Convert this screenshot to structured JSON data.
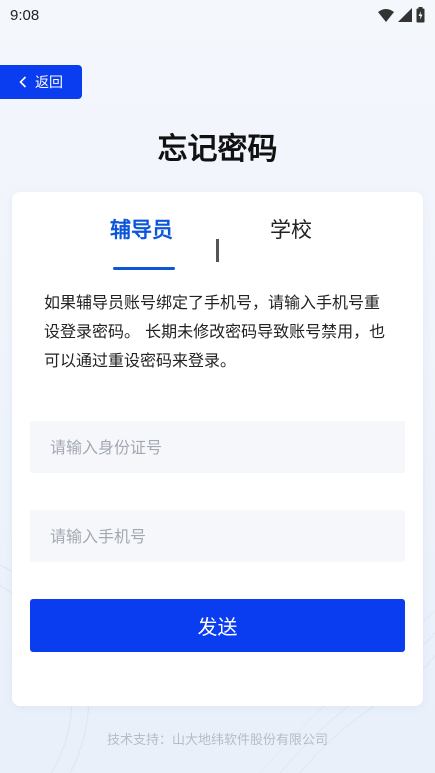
{
  "status_bar": {
    "time": "9:08"
  },
  "header": {
    "back_label": "返回",
    "title": "忘记密码"
  },
  "tabs": [
    {
      "label": "辅导员",
      "active": true
    },
    {
      "label": "学校",
      "active": false
    }
  ],
  "description": "如果辅导员账号绑定了手机号，请输入手机号重设登录密码。 长期未修改密码导致账号禁用，也可以通过重设密码来登录。",
  "form": {
    "id_placeholder": "请输入身份证号",
    "phone_placeholder": "请输入手机号",
    "send_label": "发送"
  },
  "footer": {
    "text": "技术支持：山大地纬软件股份有限公司"
  },
  "colors": {
    "accent": "#0a3cf0",
    "tab_active": "#0c57d9"
  }
}
